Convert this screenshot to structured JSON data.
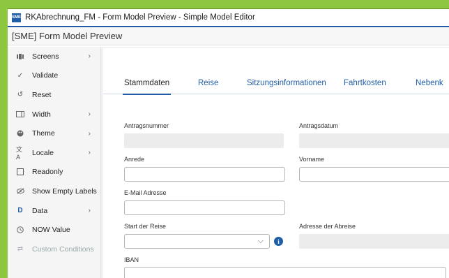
{
  "window": {
    "title": "RKAbrechnung_FM - Form Model Preview - Simple Model Editor",
    "logo_text": "SME"
  },
  "header": {
    "title": "[SME] Form Model Preview"
  },
  "sidebar": {
    "items": [
      {
        "label": "Screens",
        "icon": "screens-icon",
        "has_submenu": true
      },
      {
        "label": "Validate",
        "icon": "check-icon",
        "has_submenu": false
      },
      {
        "label": "Reset",
        "icon": "reset-icon",
        "has_submenu": false
      },
      {
        "label": "Width",
        "icon": "width-icon",
        "has_submenu": true
      },
      {
        "label": "Theme",
        "icon": "palette-icon",
        "has_submenu": true
      },
      {
        "label": "Locale",
        "icon": "translate-icon",
        "has_submenu": true
      },
      {
        "label": "Readonly",
        "icon": "checkbox-icon",
        "has_submenu": false
      },
      {
        "label": "Show Empty Labels",
        "icon": "eye-off-icon",
        "has_submenu": false
      },
      {
        "label": "Data",
        "icon": "data-icon",
        "icon_glyph": "D",
        "has_submenu": true
      },
      {
        "label": "NOW Value",
        "icon": "clock-icon",
        "has_submenu": false
      },
      {
        "label": "Custom Conditions",
        "icon": "conditions-icon",
        "has_submenu": false,
        "disabled": true
      }
    ]
  },
  "tabs": [
    {
      "label": "Stammdaten",
      "active": true
    },
    {
      "label": "Reise",
      "active": false
    },
    {
      "label": "Sitzungsinformationen",
      "active": false
    },
    {
      "label": "Fahrtkosten",
      "active": false
    },
    {
      "label": "Nebenk",
      "active": false
    }
  ],
  "form": {
    "antragsnummer_label": "Antragsnummer",
    "antragsdatum_label": "Antragsdatum",
    "anrede_label": "Anrede",
    "vorname_label": "Vorname",
    "email_label": "E-Mail Adresse",
    "start_reise_label": "Start der Reise",
    "adresse_abreise_label": "Adresse der Abreise",
    "iban_label": "IBAN"
  },
  "colors": {
    "accent": "#1f5da8",
    "frame": "#8dc63f"
  }
}
